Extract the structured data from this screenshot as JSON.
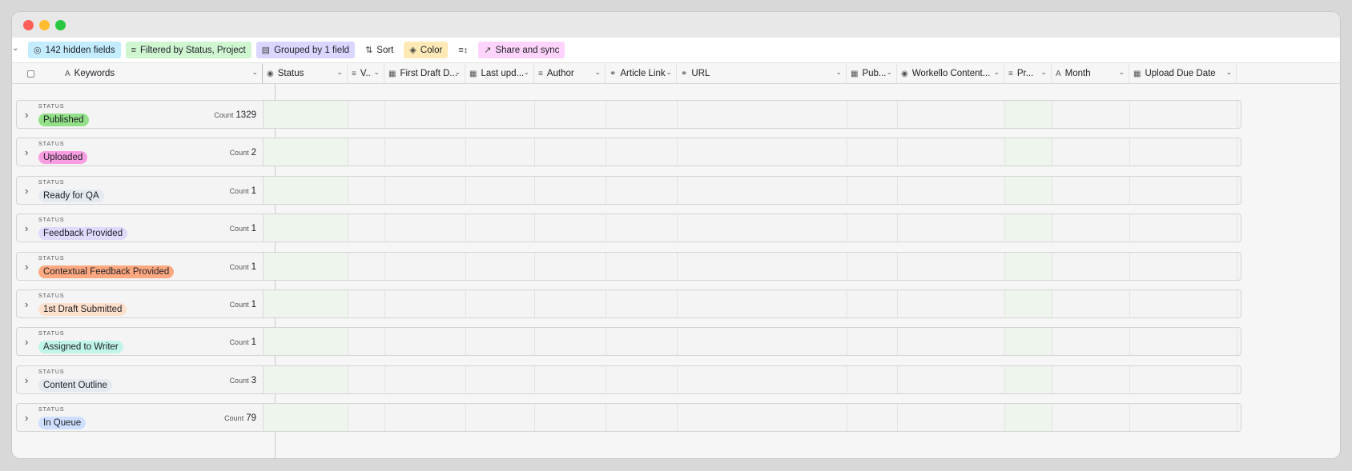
{
  "toolbar": {
    "hidden_fields": "142 hidden fields",
    "filter": "Filtered by Status, Project",
    "grouped": "Grouped by 1 field",
    "sort": "Sort",
    "color": "Color",
    "share": "Share and sync"
  },
  "columns": {
    "primary": "Keywords",
    "status": "Status",
    "v": "V..",
    "first_draft": "First Draft D...",
    "last_updated": "Last upd...",
    "author": "Author",
    "article_link": "Article Link",
    "url": "URL",
    "pub": "Pub...",
    "workello": "Workello Content...",
    "pr": "Pr...",
    "month": "Month",
    "upload_due": "Upload Due Date"
  },
  "group_field_label": "STATUS",
  "count_label": "Count",
  "groups": [
    {
      "label": "Published",
      "count": "1329",
      "color": "#93e088"
    },
    {
      "label": "Uploaded",
      "count": "2",
      "color": "#f99de2"
    },
    {
      "label": "Ready for QA",
      "count": "1",
      "color": "#e5e9f0"
    },
    {
      "label": "Feedback Provided",
      "count": "1",
      "color": "#e0dafd"
    },
    {
      "label": "Contextual Feedback Provided",
      "count": "1",
      "color": "#ffa981"
    },
    {
      "label": "1st Draft Submitted",
      "count": "1",
      "color": "#ffe0cc"
    },
    {
      "label": "Assigned to Writer",
      "count": "1",
      "color": "#c2f5e9"
    },
    {
      "label": "Content Outline",
      "count": "3",
      "color": "#e5e9f0"
    },
    {
      "label": "In Queue",
      "count": "79",
      "color": "#cfdfff"
    }
  ]
}
